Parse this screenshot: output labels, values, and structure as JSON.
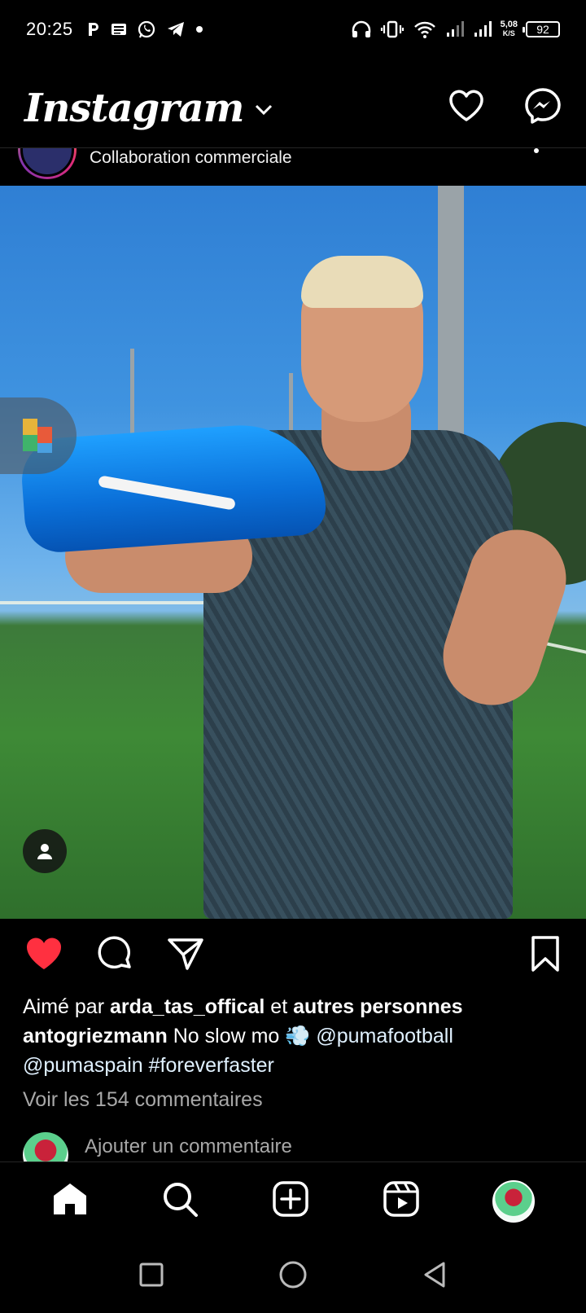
{
  "status_bar": {
    "time": "20:25",
    "left_icons": [
      "parking-icon",
      "news-icon",
      "whatsapp-icon",
      "telegram-icon",
      "dot-icon"
    ],
    "right_icons": [
      "headphones-icon",
      "vibrate-icon",
      "wifi-icon",
      "signal-icon",
      "signal-icon"
    ],
    "net_speed_value": "5,08",
    "net_speed_unit": "K/S",
    "battery": "92"
  },
  "app_header": {
    "logo": "Instagram",
    "icons": [
      "chevron-down-icon",
      "heart-outline-icon",
      "messenger-icon"
    ]
  },
  "post": {
    "subtitle": "Collaboration commerciale",
    "liked_prefix": "Aimé par ",
    "liked_user": "arda_tas_offical",
    "liked_connector": " et ",
    "liked_rest": "autres personnes",
    "author": "antogriezmann",
    "caption_text": " No slow mo 💨 ",
    "mention_1": "@pumafootball",
    "mention_2": "@pumaspain",
    "hashtag": "#foreverfaster",
    "view_comments": "Voir les 154 commentaires",
    "add_comment_placeholder": "Ajouter un commentaire",
    "liked": true
  },
  "tabs": [
    "home-icon",
    "search-icon",
    "create-icon",
    "reels-icon",
    "profile-avatar"
  ],
  "android_nav": [
    "recent-apps-icon",
    "home-circle-icon",
    "back-icon"
  ],
  "colors": {
    "background": "#000000",
    "like_red": "#ff3040",
    "muted_text": "#a8a8a8"
  }
}
